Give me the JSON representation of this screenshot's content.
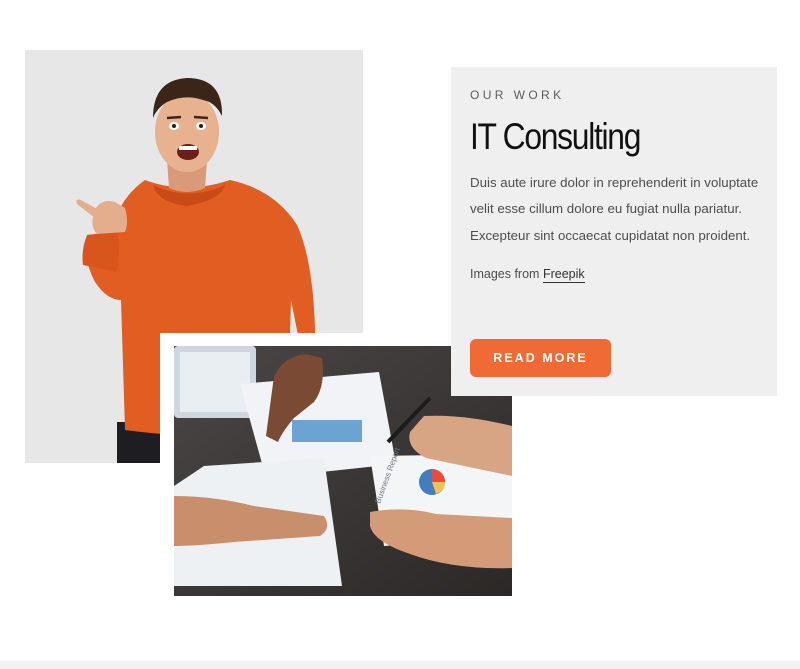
{
  "card": {
    "eyebrow": "OUR WORK",
    "title": "IT Consulting",
    "description": "Duis aute irure dolor in reprehenderit in voluptate velit esse cillum dolore eu fugiat nulla pariatur. Excepteur sint occaecat cupidatat non proident.",
    "credit_prefix": "Images from",
    "credit_link": "Freepik",
    "button_label": "READ MORE"
  },
  "images": {
    "person_photo": "excited man in orange sweater pointing",
    "meeting_photo": "team reviewing charts and business report documents",
    "report_caption": "Business Report"
  },
  "colors": {
    "accent": "#f06a35",
    "card_background": "#efefef",
    "title": "#111111",
    "body_text": "#4d4d4d"
  }
}
